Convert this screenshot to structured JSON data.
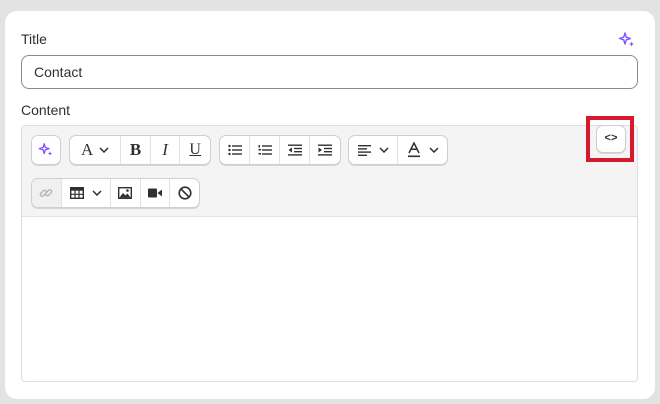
{
  "form": {
    "title_label": "Title",
    "title_value": "Contact",
    "content_label": "Content"
  },
  "toolbar": {
    "bold_glyph": "B",
    "italic_glyph": "I",
    "underline_glyph": "U",
    "font_glyph": "A",
    "code_glyph": "<>",
    "icons": [
      "sparkle-icon",
      "font-style-icon",
      "bold-icon",
      "italic-icon",
      "underline-icon",
      "bulleted-list-icon",
      "numbered-list-icon",
      "outdent-icon",
      "indent-icon",
      "align-left-icon",
      "text-color-icon",
      "link-icon",
      "table-icon",
      "image-icon",
      "video-icon",
      "clear-format-icon",
      "code-view-icon"
    ]
  },
  "colors": {
    "accent_purple": "#8051ff",
    "highlight_red": "#d8182e"
  }
}
